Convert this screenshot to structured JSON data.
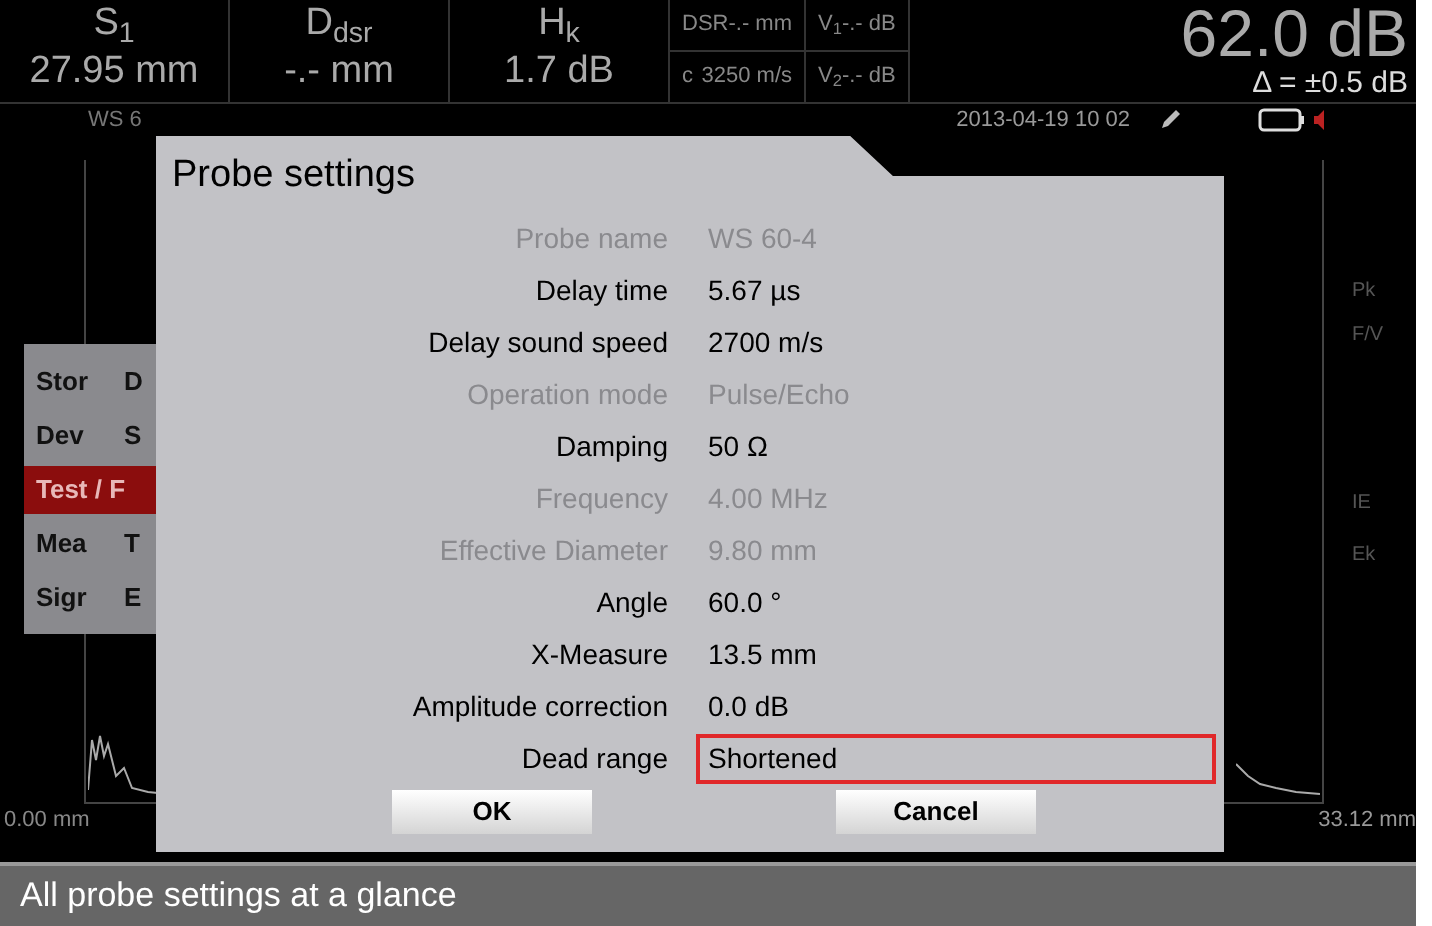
{
  "header": {
    "cells": [
      {
        "name": "S$_{1}$",
        "value": "27.95 mm"
      },
      {
        "name": "D$_{dsr}$",
        "value": "-.- mm"
      },
      {
        "name": "H$_{k}$",
        "value": "1.7 dB"
      }
    ],
    "small": [
      {
        "label": "DSR",
        "value": "-.- mm"
      },
      {
        "label": "c",
        "value": "3250 m/s"
      }
    ],
    "small2": [
      {
        "label": "V$_{1}$",
        "value": "-.- dB"
      },
      {
        "label": "V$_{2}$",
        "value": "-.- dB"
      }
    ],
    "gain": "62.0 dB",
    "delta": "Δ = ±0.5 dB"
  },
  "status": {
    "probe": "WS 6",
    "datetime": "2013-04-19 10 02"
  },
  "menu": [
    {
      "label": "Stor",
      "sub": "D",
      "selected": false
    },
    {
      "label": "Dev",
      "sub": "S",
      "selected": false
    },
    {
      "label": "Test / F",
      "selected": true
    },
    {
      "label": "Mea",
      "sub": "T",
      "selected": false
    },
    {
      "label": "Sigr",
      "sub": "E",
      "selected": false
    }
  ],
  "gates": [
    "Pk",
    "F/V",
    "IE",
    "Ek"
  ],
  "axis": {
    "start": "0.00 mm",
    "end": "33.12 mm"
  },
  "dialog": {
    "title": "Probe settings",
    "rows": [
      {
        "label": "Probe name",
        "value": "WS 60-4",
        "enabled": false,
        "selected": false
      },
      {
        "label": "Delay time",
        "value": "5.67 µs",
        "enabled": true,
        "selected": false
      },
      {
        "label": "Delay sound speed",
        "value": "2700 m/s",
        "enabled": true,
        "selected": false
      },
      {
        "label": "Operation mode",
        "value": "Pulse/Echo",
        "enabled": false,
        "selected": false
      },
      {
        "label": "Damping",
        "value": "50 Ω",
        "enabled": true,
        "selected": false
      },
      {
        "label": "Frequency",
        "value": "4.00 MHz",
        "enabled": false,
        "selected": false
      },
      {
        "label": "Effective Diameter",
        "value": "9.80 mm",
        "enabled": false,
        "selected": false
      },
      {
        "label": "Angle",
        "value": "60.0 °",
        "enabled": true,
        "selected": false
      },
      {
        "label": "X-Measure",
        "value": "13.5 mm",
        "enabled": true,
        "selected": false
      },
      {
        "label": "Amplitude correction",
        "value": "0.0 dB",
        "enabled": true,
        "selected": false
      },
      {
        "label": "Dead range",
        "value": "Shortened",
        "enabled": true,
        "selected": true
      }
    ],
    "buttons": [
      "OK",
      "Cancel"
    ]
  },
  "caption": "All probe settings at a glance"
}
